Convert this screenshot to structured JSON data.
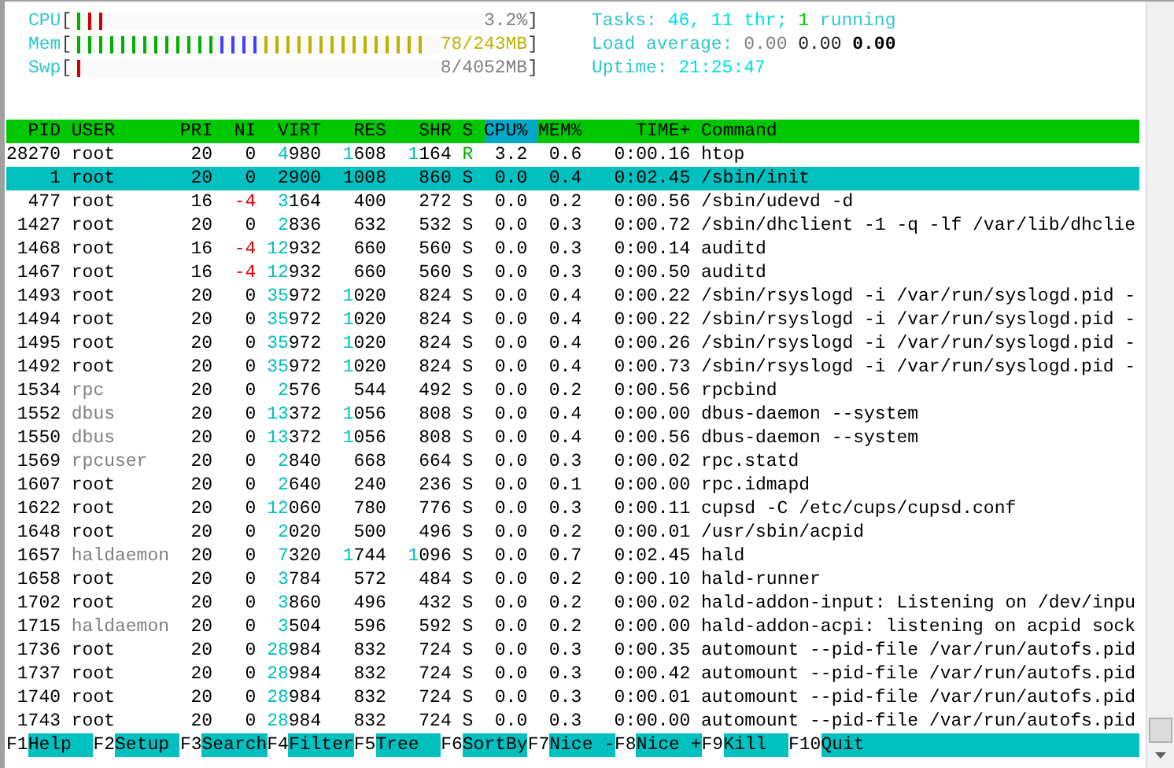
{
  "meters": [
    {
      "label": "CPU",
      "open": "[",
      "close": "]",
      "reading": "3.2%",
      "color": "#808080",
      "segments": [
        {
          "color": "#00b000",
          "level": 0.027
        },
        {
          "color": "#d00000",
          "level": 0.08
        }
      ]
    },
    {
      "label": "Mem",
      "open": "[",
      "close": "]",
      "reading": "78/243MB",
      "color": "#c0b000",
      "segments": [
        {
          "color": "#00b000",
          "level": 0.4
        },
        {
          "color": "#4040ff",
          "level": 0.51
        },
        {
          "color": "#c0b000",
          "level": 0.97
        }
      ]
    },
    {
      "label": "Swp",
      "open": "[",
      "close": "]",
      "reading": "8/4052MB",
      "color": "#808080",
      "segments": [
        {
          "color": "#d00000",
          "level": 0.03
        }
      ]
    }
  ],
  "info": [
    [
      {
        "text": "Tasks:",
        "color": "#30c8c8"
      },
      {
        "text": "46,",
        "color": "#00e0e0"
      },
      {
        "text": "11 thr;",
        "color": "#00e0e0"
      },
      {
        "text": "1",
        "color": "#00d000"
      },
      {
        "text": "running",
        "color": "#30c8c8"
      }
    ],
    [
      {
        "text": "Load average:",
        "color": "#30c8c8"
      },
      {
        "text": "0.00",
        "color": "#808080"
      },
      {
        "text": "0.00",
        "color": "#202020"
      },
      {
        "text": "0.00",
        "color": "#000000"
      }
    ],
    [
      {
        "text": "Uptime:",
        "color": "#30c8c8"
      },
      {
        "text": "21:25:47",
        "color": "#00e0e0"
      }
    ]
  ],
  "columns": [
    {
      "label": "PID",
      "sorted": false
    },
    {
      "label": "USER",
      "sorted": false
    },
    {
      "label": "PRI",
      "sorted": false
    },
    {
      "label": "NI",
      "sorted": false
    },
    {
      "label": "VIRT",
      "sorted": false
    },
    {
      "label": "RES",
      "sorted": false
    },
    {
      "label": "SHR",
      "sorted": false
    },
    {
      "label": "S",
      "sorted": false
    },
    {
      "label": "CPU%",
      "sorted": true
    },
    {
      "label": "MEM%",
      "sorted": false
    },
    {
      "label": "TIME+",
      "sorted": false
    },
    {
      "label": "Command",
      "sorted": false
    }
  ],
  "rows": [
    {
      "cells": [
        "28270",
        "root",
        "20",
        "0",
        "4980",
        "1608",
        "1164",
        "R",
        "3.2",
        "0.6",
        "0:00.16",
        "htop"
      ],
      "selected": false,
      "running": true,
      "other_user": false,
      "negative_nice": false
    },
    {
      "cells": [
        "1",
        "root",
        "20",
        "0",
        "2900",
        "1008",
        "860",
        "S",
        "0.0",
        "0.4",
        "0:02.45",
        "/sbin/init"
      ],
      "selected": true,
      "running": false,
      "other_user": false,
      "negative_nice": false
    },
    {
      "cells": [
        "477",
        "root",
        "16",
        "-4",
        "3164",
        "400",
        "272",
        "S",
        "0.0",
        "0.2",
        "0:00.56",
        "/sbin/udevd -d"
      ],
      "selected": false,
      "running": false,
      "other_user": false,
      "negative_nice": true
    },
    {
      "cells": [
        "1427",
        "root",
        "20",
        "0",
        "2836",
        "632",
        "532",
        "S",
        "0.0",
        "0.3",
        "0:00.72",
        "/sbin/dhclient -1 -q -lf /var/lib/dhclie"
      ],
      "selected": false,
      "running": false,
      "other_user": false,
      "negative_nice": false
    },
    {
      "cells": [
        "1468",
        "root",
        "16",
        "-4",
        "12932",
        "660",
        "560",
        "S",
        "0.0",
        "0.3",
        "0:00.14",
        "auditd"
      ],
      "selected": false,
      "running": false,
      "other_user": false,
      "negative_nice": true
    },
    {
      "cells": [
        "1467",
        "root",
        "16",
        "-4",
        "12932",
        "660",
        "560",
        "S",
        "0.0",
        "0.3",
        "0:00.50",
        "auditd"
      ],
      "selected": false,
      "running": false,
      "other_user": false,
      "negative_nice": true
    },
    {
      "cells": [
        "1493",
        "root",
        "20",
        "0",
        "35972",
        "1020",
        "824",
        "S",
        "0.0",
        "0.4",
        "0:00.22",
        "/sbin/rsyslogd -i /var/run/syslogd.pid -"
      ],
      "selected": false,
      "running": false,
      "other_user": false,
      "negative_nice": false
    },
    {
      "cells": [
        "1494",
        "root",
        "20",
        "0",
        "35972",
        "1020",
        "824",
        "S",
        "0.0",
        "0.4",
        "0:00.22",
        "/sbin/rsyslogd -i /var/run/syslogd.pid -"
      ],
      "selected": false,
      "running": false,
      "other_user": false,
      "negative_nice": false
    },
    {
      "cells": [
        "1495",
        "root",
        "20",
        "0",
        "35972",
        "1020",
        "824",
        "S",
        "0.0",
        "0.4",
        "0:00.26",
        "/sbin/rsyslogd -i /var/run/syslogd.pid -"
      ],
      "selected": false,
      "running": false,
      "other_user": false,
      "negative_nice": false
    },
    {
      "cells": [
        "1492",
        "root",
        "20",
        "0",
        "35972",
        "1020",
        "824",
        "S",
        "0.0",
        "0.4",
        "0:00.73",
        "/sbin/rsyslogd -i /var/run/syslogd.pid -"
      ],
      "selected": false,
      "running": false,
      "other_user": false,
      "negative_nice": false
    },
    {
      "cells": [
        "1534",
        "rpc",
        "20",
        "0",
        "2576",
        "544",
        "492",
        "S",
        "0.0",
        "0.2",
        "0:00.56",
        "rpcbind"
      ],
      "selected": false,
      "running": false,
      "other_user": true,
      "negative_nice": false
    },
    {
      "cells": [
        "1552",
        "dbus",
        "20",
        "0",
        "13372",
        "1056",
        "808",
        "S",
        "0.0",
        "0.4",
        "0:00.00",
        "dbus-daemon --system"
      ],
      "selected": false,
      "running": false,
      "other_user": true,
      "negative_nice": false
    },
    {
      "cells": [
        "1550",
        "dbus",
        "20",
        "0",
        "13372",
        "1056",
        "808",
        "S",
        "0.0",
        "0.4",
        "0:00.56",
        "dbus-daemon --system"
      ],
      "selected": false,
      "running": false,
      "other_user": true,
      "negative_nice": false
    },
    {
      "cells": [
        "1569",
        "rpcuser",
        "20",
        "0",
        "2840",
        "668",
        "664",
        "S",
        "0.0",
        "0.3",
        "0:00.02",
        "rpc.statd"
      ],
      "selected": false,
      "running": false,
      "other_user": true,
      "negative_nice": false
    },
    {
      "cells": [
        "1607",
        "root",
        "20",
        "0",
        "2640",
        "240",
        "236",
        "S",
        "0.0",
        "0.1",
        "0:00.00",
        "rpc.idmapd"
      ],
      "selected": false,
      "running": false,
      "other_user": false,
      "negative_nice": false
    },
    {
      "cells": [
        "1622",
        "root",
        "20",
        "0",
        "12060",
        "780",
        "776",
        "S",
        "0.0",
        "0.3",
        "0:00.11",
        "cupsd -C /etc/cups/cupsd.conf"
      ],
      "selected": false,
      "running": false,
      "other_user": false,
      "negative_nice": false
    },
    {
      "cells": [
        "1648",
        "root",
        "20",
        "0",
        "2020",
        "500",
        "496",
        "S",
        "0.0",
        "0.2",
        "0:00.01",
        "/usr/sbin/acpid"
      ],
      "selected": false,
      "running": false,
      "other_user": false,
      "negative_nice": false
    },
    {
      "cells": [
        "1657",
        "haldaemon",
        "20",
        "0",
        "7320",
        "1744",
        "1096",
        "S",
        "0.0",
        "0.7",
        "0:02.45",
        "hald"
      ],
      "selected": false,
      "running": false,
      "other_user": true,
      "negative_nice": false
    },
    {
      "cells": [
        "1658",
        "root",
        "20",
        "0",
        "3784",
        "572",
        "484",
        "S",
        "0.0",
        "0.2",
        "0:00.10",
        "hald-runner"
      ],
      "selected": false,
      "running": false,
      "other_user": false,
      "negative_nice": false
    },
    {
      "cells": [
        "1702",
        "root",
        "20",
        "0",
        "3860",
        "496",
        "432",
        "S",
        "0.0",
        "0.2",
        "0:00.02",
        "hald-addon-input: Listening on /dev/inpu"
      ],
      "selected": false,
      "running": false,
      "other_user": false,
      "negative_nice": false
    },
    {
      "cells": [
        "1715",
        "haldaemon",
        "20",
        "0",
        "3504",
        "596",
        "592",
        "S",
        "0.0",
        "0.2",
        "0:00.00",
        "hald-addon-acpi: listening on acpid sock"
      ],
      "selected": false,
      "running": false,
      "other_user": true,
      "negative_nice": false
    },
    {
      "cells": [
        "1736",
        "root",
        "20",
        "0",
        "28984",
        "832",
        "724",
        "S",
        "0.0",
        "0.3",
        "0:00.35",
        "automount --pid-file /var/run/autofs.pid"
      ],
      "selected": false,
      "running": false,
      "other_user": false,
      "negative_nice": false
    },
    {
      "cells": [
        "1737",
        "root",
        "20",
        "0",
        "28984",
        "832",
        "724",
        "S",
        "0.0",
        "0.3",
        "0:00.42",
        "automount --pid-file /var/run/autofs.pid"
      ],
      "selected": false,
      "running": false,
      "other_user": false,
      "negative_nice": false
    },
    {
      "cells": [
        "1740",
        "root",
        "20",
        "0",
        "28984",
        "832",
        "724",
        "S",
        "0.0",
        "0.3",
        "0:00.01",
        "automount --pid-file /var/run/autofs.pid"
      ],
      "selected": false,
      "running": false,
      "other_user": false,
      "negative_nice": false
    },
    {
      "cells": [
        "1743",
        "root",
        "20",
        "0",
        "28984",
        "832",
        "724",
        "S",
        "0.0",
        "0.3",
        "0:00.00",
        "automount --pid-file /var/run/autofs.pid"
      ],
      "selected": false,
      "running": false,
      "other_user": false,
      "negative_nice": false
    }
  ],
  "function_keys": [
    {
      "key": "F1",
      "label": "Help"
    },
    {
      "key": "F2",
      "label": "Setup"
    },
    {
      "key": "F3",
      "label": "Search"
    },
    {
      "key": "F4",
      "label": "Filter"
    },
    {
      "key": "F5",
      "label": "Tree"
    },
    {
      "key": "F6",
      "label": "SortBy"
    },
    {
      "key": "F7",
      "label": "Nice -"
    },
    {
      "key": "F8",
      "label": "Nice +"
    },
    {
      "key": "F9",
      "label": "Kill"
    },
    {
      "key": "F10",
      "label": "Quit"
    }
  ]
}
